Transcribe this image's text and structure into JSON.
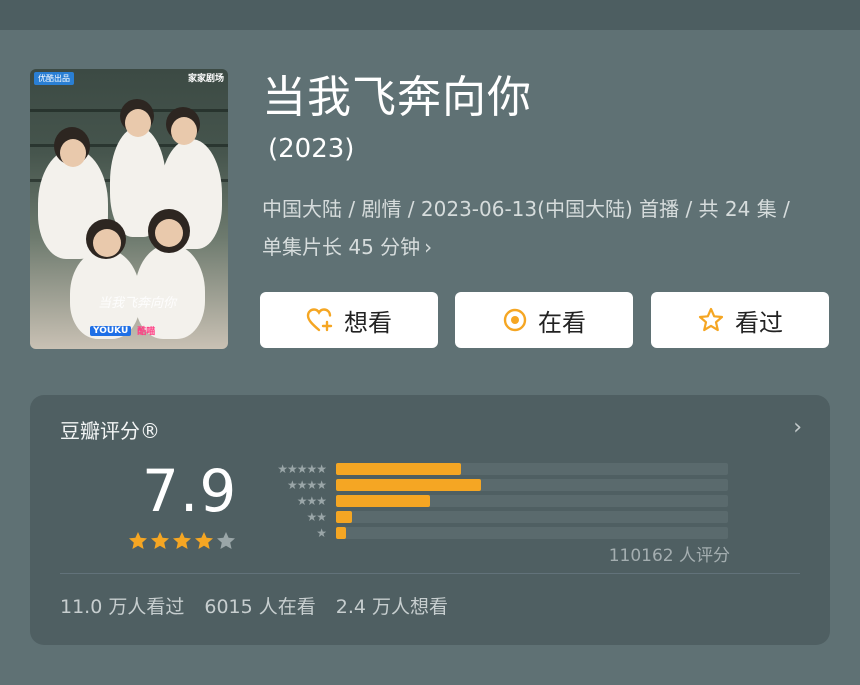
{
  "poster": {
    "badge_left": "优酷出品",
    "badge_right": "家家剧场",
    "script_title": "当我飞奔向你",
    "brand_a": "YOUKU",
    "brand_b": "酷喵"
  },
  "title": "当我飞奔向你",
  "year": "(2023)",
  "meta_line1": "中国大陆 / 剧情 / 2023-06-13(中国大陆) 首播 / 共 24 集 /",
  "meta_line2": "单集片长 45 分钟",
  "actions": [
    {
      "label": "想看",
      "icon": "heart-plus-icon"
    },
    {
      "label": "在看",
      "icon": "circle-dot-icon"
    },
    {
      "label": "看过",
      "icon": "star-outline-icon"
    }
  ],
  "rating": {
    "section_title": "豆瓣评分®",
    "score": "7.9",
    "stars_filled": 4,
    "stars_total": 5,
    "distribution": [
      {
        "stars": "★★★★★",
        "fraction": 0.32
      },
      {
        "stars": "★★★★",
        "fraction": 0.37
      },
      {
        "stars": "★★★",
        "fraction": 0.24
      },
      {
        "stars": "★★",
        "fraction": 0.04
      },
      {
        "stars": "★",
        "fraction": 0.025
      }
    ],
    "count": "110162 人评分",
    "stats": [
      "11.0 万人看过",
      "6015 人在看",
      "2.4 万人想看"
    ]
  },
  "colors": {
    "background": "#5f7174",
    "card": "#4f5f62",
    "accent": "#f5a623",
    "star_empty": "#9aa6a8"
  }
}
